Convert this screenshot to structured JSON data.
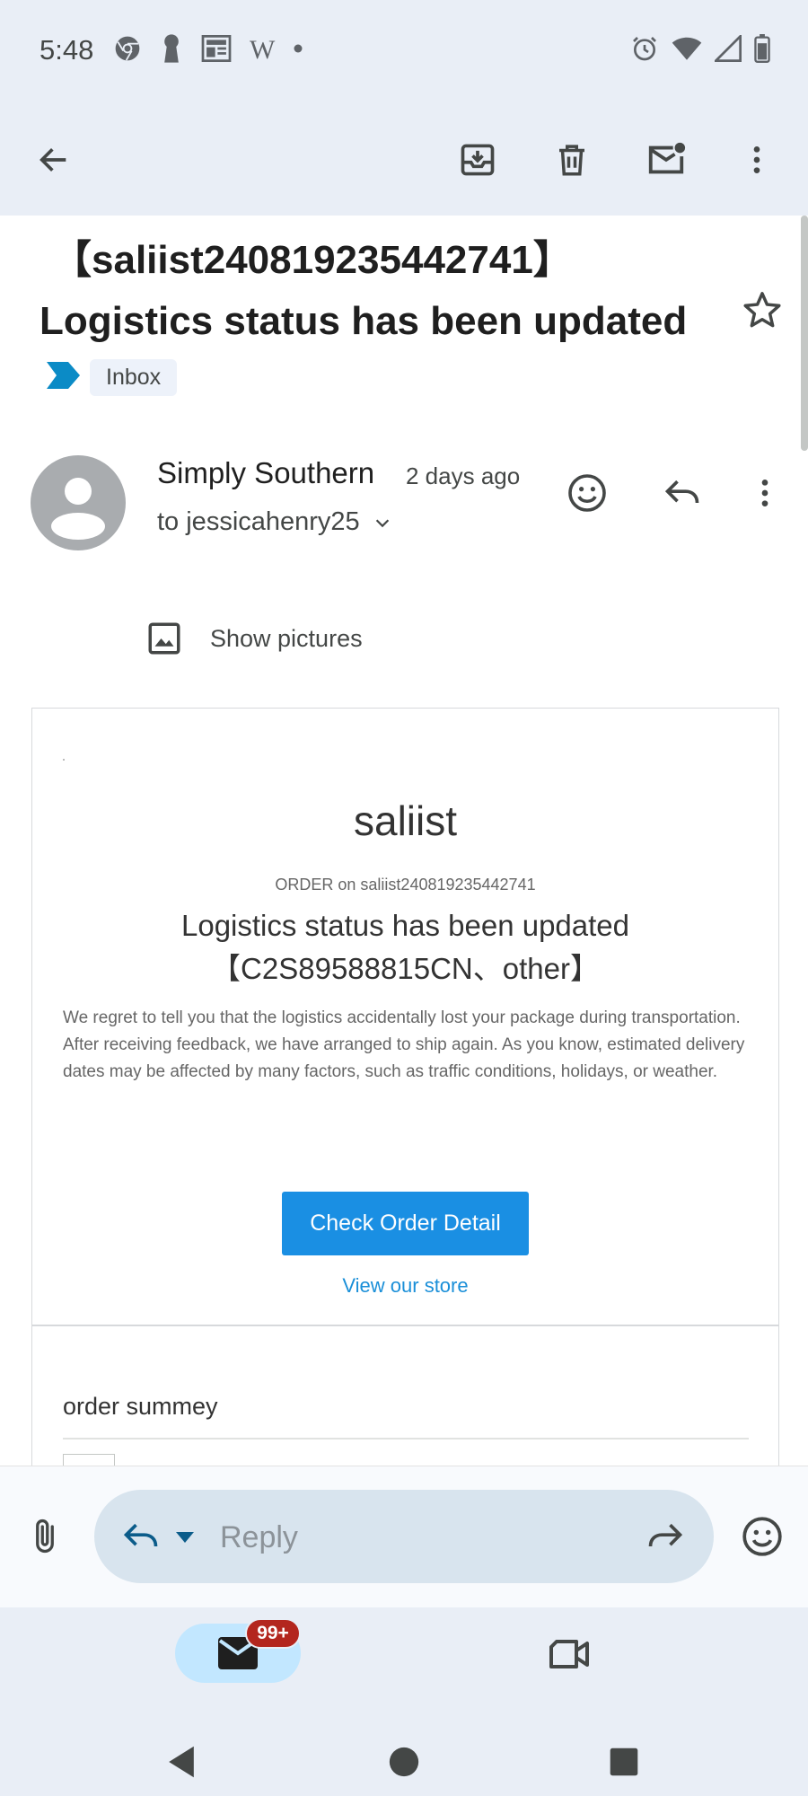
{
  "status_bar": {
    "time": "5:48",
    "left_icons": [
      "chrome-icon",
      "keyhole-icon",
      "news-icon",
      "wikipedia-icon",
      "dot-icon"
    ],
    "wikipedia_glyph": "W",
    "right_icons": [
      "alarm-icon",
      "wifi-icon",
      "cell-signal-icon",
      "battery-icon"
    ]
  },
  "toolbar": {
    "actions": [
      "back-icon",
      "archive-icon",
      "delete-icon",
      "mark-unread-icon",
      "more-vert-icon"
    ]
  },
  "email": {
    "subject_line1": "【saliist240819235442741】",
    "subject_line2": "Logistics status has been updated",
    "label": "Inbox",
    "sender": "Simply Southern",
    "time": "2 days ago",
    "recipient": "to jessicahenry25",
    "show_pictures": "Show pictures"
  },
  "card": {
    "brand": "saliist",
    "order_line": "ORDER on saliist240819235442741",
    "title_line1": "Logistics status has been updated",
    "title_line2": "【C2S89588815CN、other】",
    "body": "We regret to tell you that the logistics accidentally lost your package during transportation. After receiving feedback, we have arranged to ship again. As you know, estimated delivery dates may be affected by many factors, such as traffic conditions, holidays, or weather.",
    "cta": "Check Order Detail",
    "store_link": "View our store",
    "summary_heading": "order summey"
  },
  "reply_bar": {
    "placeholder": "Reply"
  },
  "bottom_nav": {
    "mail_badge": "99+"
  },
  "colors": {
    "accent_button": "#1a8fe3",
    "link": "#1a8fd8",
    "badge": "#b3261e",
    "label_arrow": "#0b8bc6",
    "surface": "#e9eef6"
  }
}
